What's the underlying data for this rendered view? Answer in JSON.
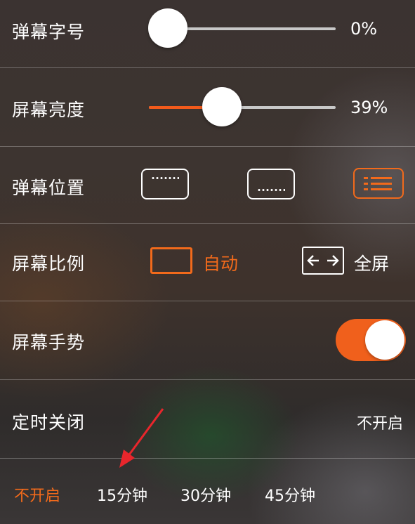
{
  "danmu_size": {
    "label": "弹幕字号",
    "value_text": "0%",
    "level": 0
  },
  "brightness": {
    "label": "屏幕亮度",
    "value_text": "39%",
    "level": 0.39
  },
  "danmu_position": {
    "label": "弹幕位置",
    "options": [
      "top",
      "bottom",
      "full"
    ],
    "selected": "full"
  },
  "aspect_ratio": {
    "label": "屏幕比例",
    "auto_label": "自动",
    "full_label": "全屏",
    "selected": "auto"
  },
  "gesture": {
    "label": "屏幕手势",
    "enabled": true
  },
  "sleep_timer": {
    "label": "定时关闭",
    "current": "不开启",
    "options": [
      "不开启",
      "15分钟",
      "30分钟",
      "45分钟"
    ],
    "selected": "不开启"
  },
  "colors": {
    "accent": "#f26a1b",
    "text": "#ffffff",
    "track": "#c8c8c8"
  }
}
